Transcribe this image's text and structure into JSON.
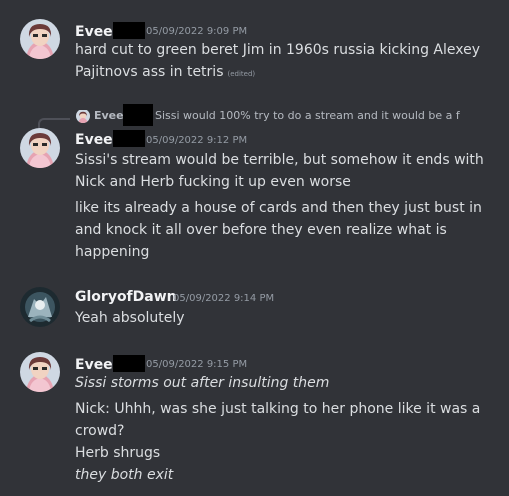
{
  "messages": [
    {
      "author": "Evee",
      "timestamp": "05/09/2022 9:09 PM",
      "lines": [
        {
          "text": "hard cut to green beret Jim in 1960s russia kicking Alexey",
          "italic": false
        },
        {
          "text": "Pajitnovs ass in tetris",
          "italic": false
        }
      ],
      "edited_label": "(edited)"
    },
    {
      "reply": {
        "author": "Evee",
        "text": "Sissi would 100% try to do a stream and it would be a f"
      },
      "author": "Evee",
      "timestamp": "05/09/2022 9:12 PM",
      "lines": [
        {
          "text": "Sissi's stream would be terrible, but somehow it ends with",
          "italic": false
        },
        {
          "text": "Nick and Herb fucking it up even worse",
          "italic": false
        },
        {
          "text": "like its already a house of cards and then they just bust in",
          "italic": false
        },
        {
          "text": "and knock it all over before they even realize what is",
          "italic": false
        },
        {
          "text": "happening",
          "italic": false
        }
      ]
    },
    {
      "author": "GloryofDawn",
      "timestamp": "05/09/2022 9:14 PM",
      "lines": [
        {
          "text": "Yeah absolutely",
          "italic": false
        }
      ]
    },
    {
      "author": "Evee",
      "timestamp": "05/09/2022 9:15 PM",
      "lines": [
        {
          "text": "Sissi storms out after insulting them",
          "italic": true
        },
        {
          "text": "Nick: Uhhh, was she just talking to her phone like it was a",
          "italic": false
        },
        {
          "text": "crowd?",
          "italic": false
        },
        {
          "text": "Herb shrugs",
          "italic": false
        },
        {
          "text": "they both exit",
          "italic": true
        }
      ]
    }
  ]
}
